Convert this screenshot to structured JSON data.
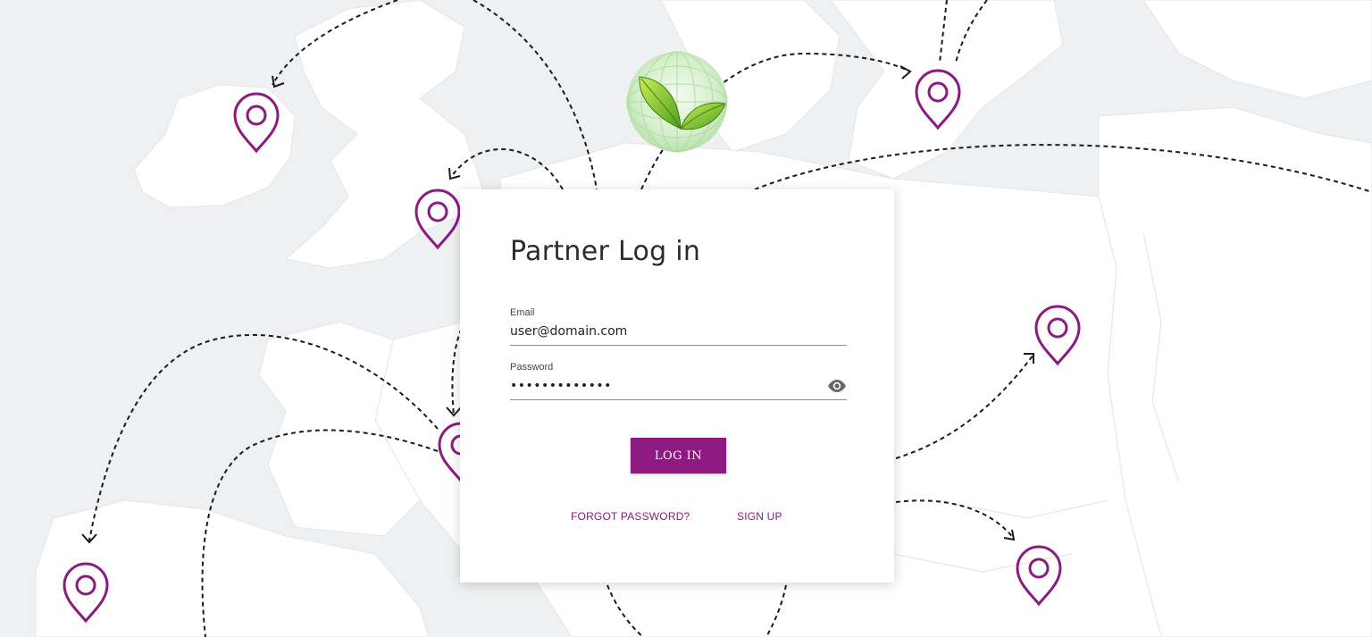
{
  "brand": {
    "accent_color": "#8c1a80",
    "logo_icon": "leaf-globe-icon"
  },
  "login": {
    "title": "Partner Log in",
    "email": {
      "label": "Email",
      "value": "user@domain.com"
    },
    "password": {
      "label": "Password",
      "masked_value": "•••••••••••••",
      "toggle_icon": "eye-icon"
    },
    "submit_label": "LOG IN",
    "forgot_label": "FORGOT PASSWORD?",
    "signup_label": "SIGN UP"
  },
  "background": {
    "marker_icon": "location-pin-icon",
    "route_style": "dashed-arrow"
  }
}
